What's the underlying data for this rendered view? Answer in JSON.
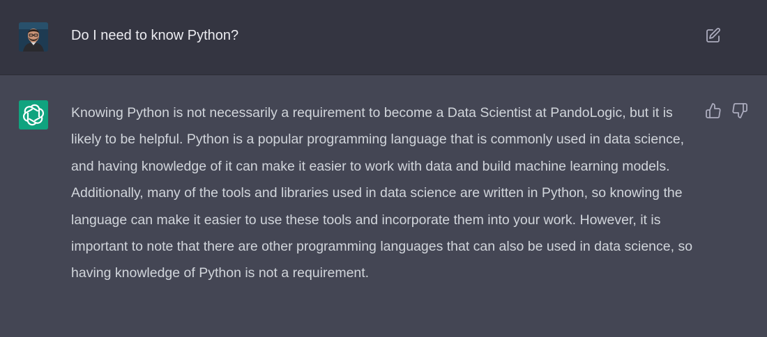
{
  "user_message": {
    "text": "Do I need to know Python?",
    "avatar": "user-photo",
    "actions": {
      "edit_icon": "edit-icon"
    }
  },
  "assistant_message": {
    "avatar": "openai-logo-icon",
    "avatar_color": "#10a37f",
    "text": "Knowing Python is not necessarily a requirement to become a Data Scientist at PandoLogic, but it is likely to be helpful. Python is a popular programming language that is commonly used in data science, and having knowledge of it can make it easier to work with data and build machine learning models. Additionally, many of the tools and libraries used in data science are written in Python, so knowing the language can make it easier to use these tools and incorporate them into your work. However, it is important to note that there are other programming languages that can also be used in data science, so having knowledge of Python is not a requirement.",
    "actions": {
      "thumbs_up_icon": "thumbs-up-icon",
      "thumbs_down_icon": "thumbs-down-icon"
    }
  },
  "colors": {
    "user_bg": "#343541",
    "assistant_bg": "#444654",
    "text": "#d1d5db",
    "icon": "#acacbe"
  }
}
